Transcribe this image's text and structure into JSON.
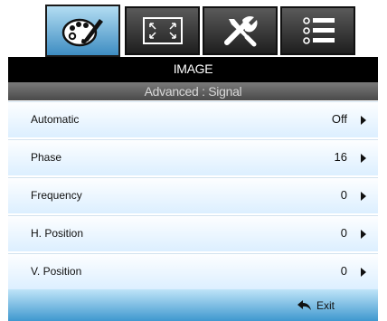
{
  "tabs": [
    {
      "icon": "palette-brush-icon",
      "active": true
    },
    {
      "icon": "screen-resize-icon",
      "active": false
    },
    {
      "icon": "tools-icon",
      "active": false
    },
    {
      "icon": "list-icon",
      "active": false
    }
  ],
  "header": {
    "title": "IMAGE",
    "subtitle": "Advanced : Signal"
  },
  "menu": {
    "items": [
      {
        "label": "Automatic",
        "value": "Off"
      },
      {
        "label": "Phase",
        "value": "16"
      },
      {
        "label": "Frequency",
        "value": "0"
      },
      {
        "label": "H. Position",
        "value": "0"
      },
      {
        "label": "V. Position",
        "value": "0"
      }
    ]
  },
  "footer": {
    "exit_label": "Exit",
    "exit_icon": "return-arrow-icon"
  },
  "colors": {
    "accent": "#3f98cf",
    "header_bg": "#000000",
    "row_gradient_bottom": "#dcefff"
  }
}
